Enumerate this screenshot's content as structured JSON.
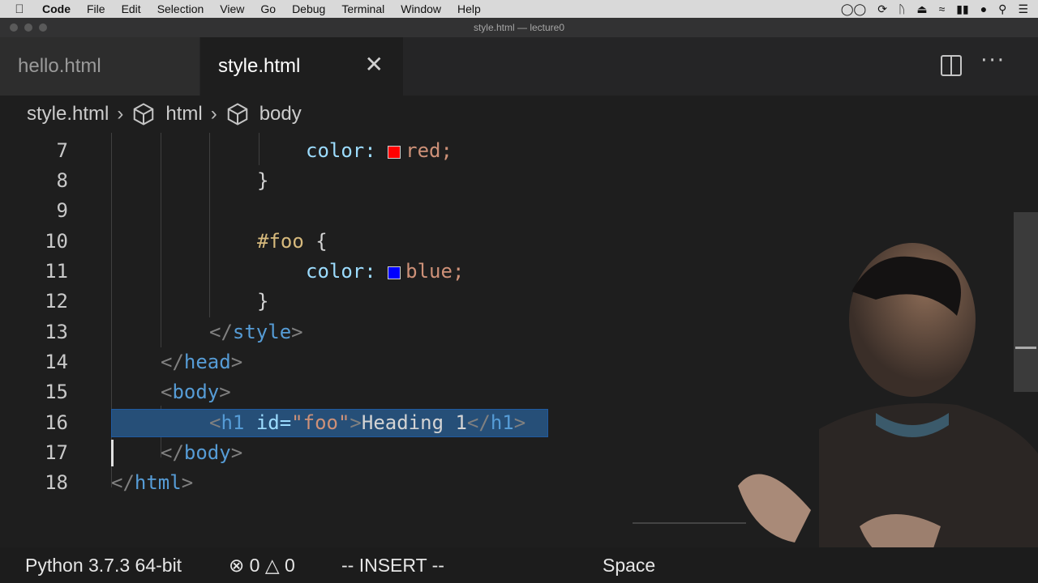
{
  "menubar": {
    "app": "Code",
    "items": [
      "File",
      "Edit",
      "Selection",
      "View",
      "Go",
      "Debug",
      "Terminal",
      "Window",
      "Help"
    ]
  },
  "window": {
    "title": "style.html — lecture0"
  },
  "tabs": [
    {
      "label": "hello.html",
      "active": false
    },
    {
      "label": "style.html",
      "active": true
    }
  ],
  "breadcrumb": [
    "style.html",
    "html",
    "body"
  ],
  "editor": {
    "line_numbers": [
      "7",
      "8",
      "9",
      "10",
      "11",
      "12",
      "13",
      "14",
      "15",
      "16",
      "17",
      "18"
    ],
    "lines": {
      "l7": {
        "prop": "color:",
        "val": "red;"
      },
      "l8": {
        "brace": "}"
      },
      "l10": {
        "sel": "#foo",
        "brace": "{"
      },
      "l11": {
        "prop": "color:",
        "val": "blue;"
      },
      "l12": {
        "brace": "}"
      },
      "l13": {
        "open": "</",
        "name": "style",
        "close": ">"
      },
      "l14": {
        "open": "</",
        "name": "head",
        "close": ">"
      },
      "l15": {
        "open": "<",
        "name": "body",
        "close": ">"
      },
      "l16": {
        "open": "<",
        "name": "h1",
        "attr": "id=",
        "str": "\"foo\"",
        "gt": ">",
        "text": "Heading 1",
        "open2": "</",
        "name2": "h1",
        "close2": ">"
      },
      "l17": {
        "open": "</",
        "name": "body",
        "close": ">"
      },
      "l18": {
        "open": "</",
        "name": "html",
        "close": ">"
      }
    },
    "swatch_colors": {
      "red": "#ff0000",
      "blue": "#0000ff"
    }
  },
  "statusbar": {
    "python": "Python 3.7.3 64-bit",
    "errors": "0",
    "warnings": "0",
    "mode": "-- INSERT --",
    "spaces": "Space"
  }
}
